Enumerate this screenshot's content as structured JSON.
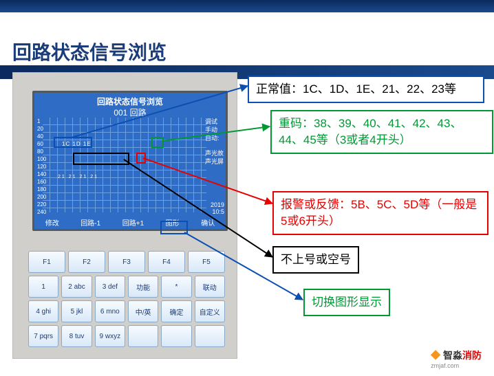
{
  "slide": {
    "title": "回路状态信号浏览"
  },
  "device": {
    "screen": {
      "title": "回路状态信号浏览",
      "subtitle": "001 回路",
      "data_row_a": "1C 1D 1E",
      "data_row_b": "21 21 21 21",
      "side1": "调试",
      "side2": "手动",
      "side3": "自动:",
      "side4": "声光故",
      "side5": "声光屏",
      "time": "2019\n10:5",
      "fn_modify": "修改",
      "fn_loop_minus": "回路-1",
      "fn_loop_plus": "回路+1",
      "fn_graph": "图形",
      "fn_confirm": "确认",
      "row_labels": "1\n20\n40\n60\n80\n100\n120\n140\n160\n180\n200\n220\n240"
    },
    "keys": {
      "f1": "F1",
      "f2": "F2",
      "f3": "F3",
      "f4": "F4",
      "f5": "F5",
      "k1": "1",
      "k2": "2 abc",
      "k3": "3 def",
      "k_func": "功能",
      "k_star": "*",
      "k_check": "联动",
      "k4": "4 ghi",
      "k5": "5 jkl",
      "k6": "6 mno",
      "k_lang": "中/英",
      "k_ok": "确定",
      "k_cancel": "自定义",
      "k7": "7 pqrs",
      "k8": "8 tuv",
      "k9": "9 wxyz"
    }
  },
  "notes": {
    "normal": "正常值：1C、1D、1E、21、22、23等",
    "duplicate": "重码：38、39、40、41、42、43、44、45等（3或者4开头）",
    "alarm": "报警或反馈：5B、5C、5D等（一般是5或6开头）",
    "null": "不上号或空号",
    "switch": "切换图形显示"
  },
  "footer": {
    "brand_a": "智淼",
    "brand_b": "消防",
    "url": "zmjaf.com"
  }
}
